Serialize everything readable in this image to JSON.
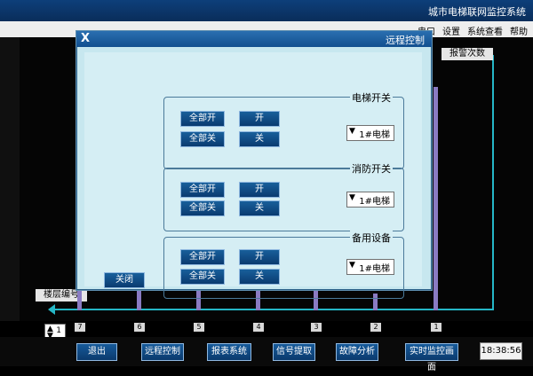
{
  "window": {
    "title": "城市电梯联网监控系统"
  },
  "menu": {
    "items": [
      "串口",
      "设置",
      "系统查看",
      "帮助"
    ]
  },
  "chart_data": {
    "type": "bar",
    "xlabel": "楼层编号",
    "ylabel": "报警次数",
    "categories": [
      "1",
      "2",
      "3",
      "4",
      "5",
      "6",
      "7"
    ],
    "values": [
      68,
      5,
      8,
      10,
      10,
      10,
      15
    ],
    "ylim": [
      0,
      75
    ]
  },
  "controls": {
    "stepper": "1"
  },
  "toolbar": {
    "buttons": [
      "实时监控画面",
      "故障分析",
      "信号提取",
      "报表系统",
      "远程控制",
      "退出"
    ],
    "clock": "18:38:56"
  },
  "dialog": {
    "title": "远程控制",
    "close_label": "X",
    "groups": [
      {
        "label": "电梯开关",
        "select": "1#电梯",
        "buttons": [
          "开",
          "全部开",
          "关",
          "全部关"
        ]
      },
      {
        "label": "消防开关",
        "select": "1#电梯",
        "buttons": [
          "开",
          "全部开",
          "关",
          "全部关"
        ]
      },
      {
        "label": "备用设备",
        "select": "1#电梯",
        "buttons": [
          "开",
          "全部开",
          "关",
          "全部关"
        ]
      }
    ],
    "close_button": "关闭"
  }
}
